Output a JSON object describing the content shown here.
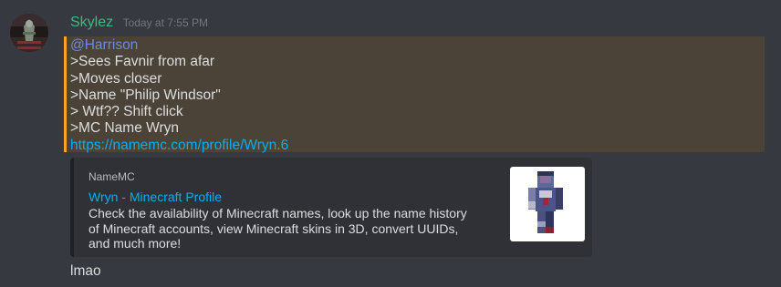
{
  "message": {
    "author": "Skylez",
    "timestamp": "Today at 7:55 PM",
    "mention": "@Harrison",
    "lines": [
      ">Sees Favnir from afar",
      ">Moves closer",
      ">Name \"Philip Windsor\"",
      "> Wtf?? Shift click",
      ">MC Name Wryn"
    ],
    "link": "https://namemc.com/profile/Wryn.6"
  },
  "embed": {
    "provider": "NameMC",
    "title": "Wryn - Minecraft Profile",
    "description_lines": [
      "Check the availability of Minecraft names, look up the name history",
      "of Minecraft accounts, view Minecraft skins in 3D, convert UUIDs,",
      "and much more!"
    ],
    "thumbnail_icon": "minecraft-skin-render"
  },
  "followup": {
    "text": "lmao"
  },
  "colors": {
    "background": "#36393f",
    "username": "#43b581",
    "mention": "#7289da",
    "link": "#00b0f4",
    "highlight_bg": "#4b4337",
    "highlight_bar": "#faa61a",
    "embed_bg": "#2f3136"
  }
}
